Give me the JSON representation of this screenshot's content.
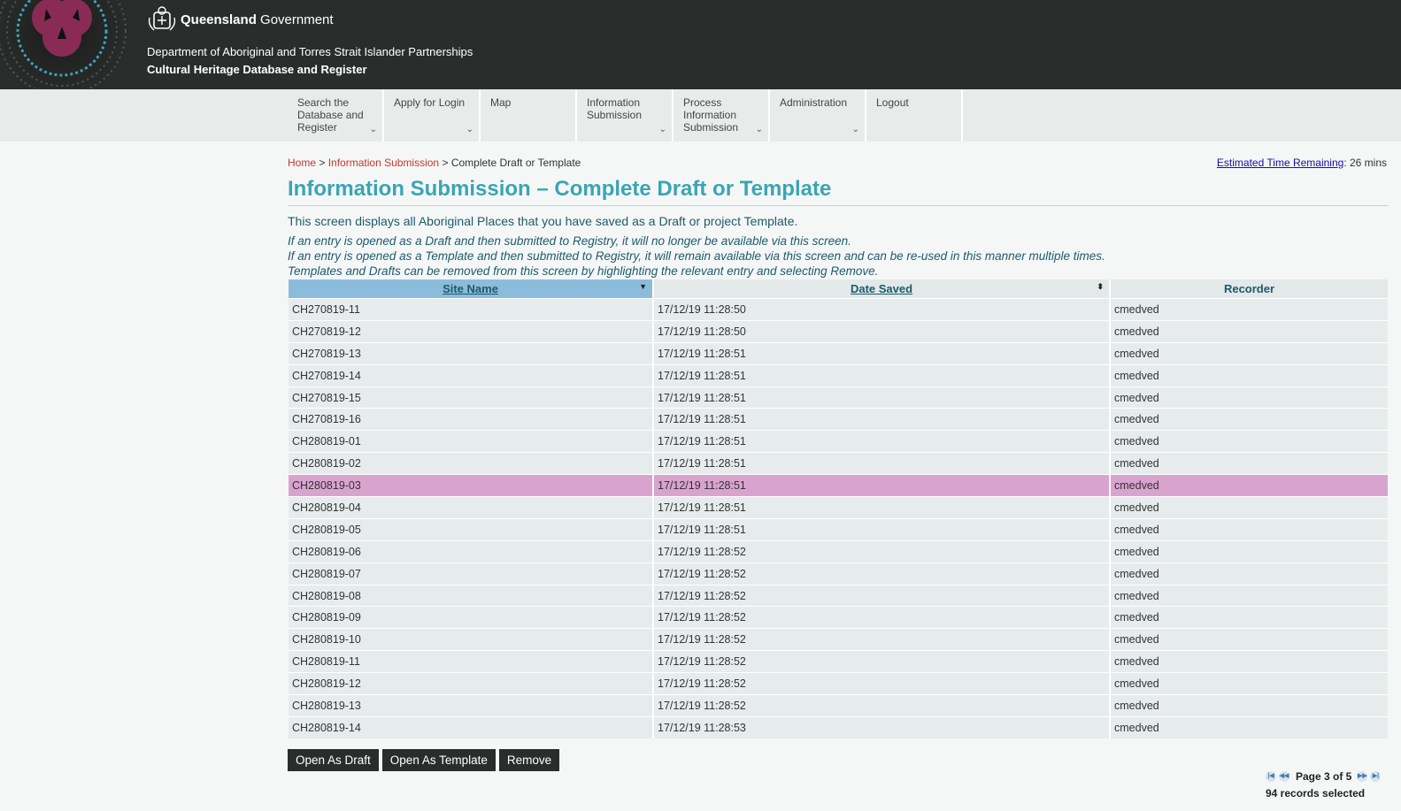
{
  "header": {
    "gov_name_bold": "Queensland",
    "gov_name_rest": " Government",
    "department": "Department of Aboriginal and Torres Strait Islander Partnerships",
    "subtitle": "Cultural Heritage Database and Register"
  },
  "nav": {
    "items": [
      {
        "label": "Search the Database and Register",
        "has_dropdown": true
      },
      {
        "label": "Apply for Login",
        "has_dropdown": true
      },
      {
        "label": "Map",
        "has_dropdown": false
      },
      {
        "label": "Information Submission",
        "has_dropdown": true
      },
      {
        "label": "Process Information Submission",
        "has_dropdown": true
      },
      {
        "label": "Administration",
        "has_dropdown": true
      },
      {
        "label": "Logout",
        "has_dropdown": false
      }
    ]
  },
  "breadcrumb": {
    "home": "Home",
    "sep": ">",
    "section": "Information Submission",
    "current": "Complete Draft or Template"
  },
  "session": {
    "label": "Estimated Time Remaining",
    "value": ": 26 mins"
  },
  "page": {
    "title": "Information Submission – Complete Draft or Template",
    "intro": "This screen displays all Aboriginal Places that you have saved as a Draft or project Template.",
    "notes": [
      "If an entry is opened as a Draft and then submitted to Registry, it will no longer be available via this screen.",
      "If an entry is opened as a Template and then submitted to Registry, it will remain available via this screen and can be re-used in this manner multiple times.",
      "Templates and Drafts can be removed from this screen by highlighting the relevant entry and selecting Remove."
    ]
  },
  "table": {
    "columns": [
      "Site Name",
      "Date Saved",
      "Recorder"
    ],
    "rows": [
      [
        "CH270819-11",
        "17/12/19 11:28:50",
        "cmedved"
      ],
      [
        "CH270819-12",
        "17/12/19 11:28:50",
        "cmedved"
      ],
      [
        "CH270819-13",
        "17/12/19 11:28:51",
        "cmedved"
      ],
      [
        "CH270819-14",
        "17/12/19 11:28:51",
        "cmedved"
      ],
      [
        "CH270819-15",
        "17/12/19 11:28:51",
        "cmedved"
      ],
      [
        "CH270819-16",
        "17/12/19 11:28:51",
        "cmedved"
      ],
      [
        "CH280819-01",
        "17/12/19 11:28:51",
        "cmedved"
      ],
      [
        "CH280819-02",
        "17/12/19 11:28:51",
        "cmedved"
      ],
      [
        "CH280819-03",
        "17/12/19 11:28:51",
        "cmedved"
      ],
      [
        "CH280819-04",
        "17/12/19 11:28:51",
        "cmedved"
      ],
      [
        "CH280819-05",
        "17/12/19 11:28:51",
        "cmedved"
      ],
      [
        "CH280819-06",
        "17/12/19 11:28:52",
        "cmedved"
      ],
      [
        "CH280819-07",
        "17/12/19 11:28:52",
        "cmedved"
      ],
      [
        "CH280819-08",
        "17/12/19 11:28:52",
        "cmedved"
      ],
      [
        "CH280819-09",
        "17/12/19 11:28:52",
        "cmedved"
      ],
      [
        "CH280819-10",
        "17/12/19 11:28:52",
        "cmedved"
      ],
      [
        "CH280819-11",
        "17/12/19 11:28:52",
        "cmedved"
      ],
      [
        "CH280819-12",
        "17/12/19 11:28:52",
        "cmedved"
      ],
      [
        "CH280819-13",
        "17/12/19 11:28:52",
        "cmedved"
      ],
      [
        "CH280819-14",
        "17/12/19 11:28:53",
        "cmedved"
      ]
    ],
    "selected_row": 8
  },
  "buttons": {
    "open_draft": "Open As Draft",
    "open_template": "Open As Template",
    "remove": "Remove"
  },
  "pager": {
    "text": "Page 3 of 5",
    "records": "94 records selected"
  },
  "colors": {
    "header_bg": "#2b2d2d",
    "title": "#3aa5b4",
    "link_red": "#c0392b",
    "selected_row": "#d9a3d0",
    "active_header": "#8cbcdc"
  }
}
